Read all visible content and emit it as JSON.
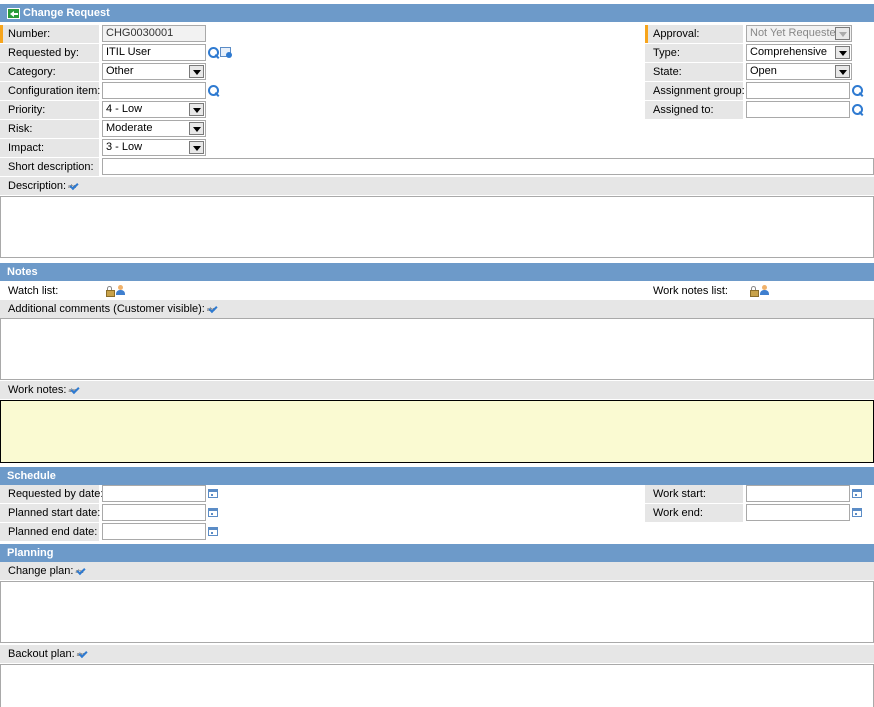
{
  "header": {
    "title": "Change Request"
  },
  "fields": {
    "number": {
      "label": "Number:",
      "value": "CHG0030001"
    },
    "requested_by": {
      "label": "Requested by:",
      "value": "ITIL User"
    },
    "category": {
      "label": "Category:",
      "value": "Other"
    },
    "configuration_item": {
      "label": "Configuration item:",
      "value": ""
    },
    "priority": {
      "label": "Priority:",
      "value": "4 - Low"
    },
    "risk": {
      "label": "Risk:",
      "value": "Moderate"
    },
    "impact": {
      "label": "Impact:",
      "value": "3 - Low"
    },
    "short_description": {
      "label": "Short description:",
      "value": ""
    },
    "description": {
      "label": "Description:"
    },
    "approval": {
      "label": "Approval:",
      "value": "Not Yet Requested"
    },
    "type": {
      "label": "Type:",
      "value": "Comprehensive"
    },
    "state": {
      "label": "State:",
      "value": "Open"
    },
    "assignment_group": {
      "label": "Assignment group:",
      "value": ""
    },
    "assigned_to": {
      "label": "Assigned to:",
      "value": ""
    }
  },
  "notes": {
    "title": "Notes",
    "watch_list": "Watch list:",
    "work_notes_list": "Work notes list:",
    "additional_comments": "Additional comments (Customer visible):",
    "work_notes": "Work notes:"
  },
  "schedule": {
    "title": "Schedule",
    "requested_by_date": "Requested by date:",
    "planned_start_date": "Planned start date:",
    "planned_end_date": "Planned end date:",
    "work_start": "Work start:",
    "work_end": "Work end:"
  },
  "planning": {
    "title": "Planning",
    "change_plan": "Change plan:",
    "backout_plan": "Backout plan:"
  },
  "colors": {
    "section_header": "#6d9ac9",
    "label_bg": "#e6e6e6",
    "mandatory": "#f7a51c",
    "work_notes_bg": "#fafad2"
  }
}
